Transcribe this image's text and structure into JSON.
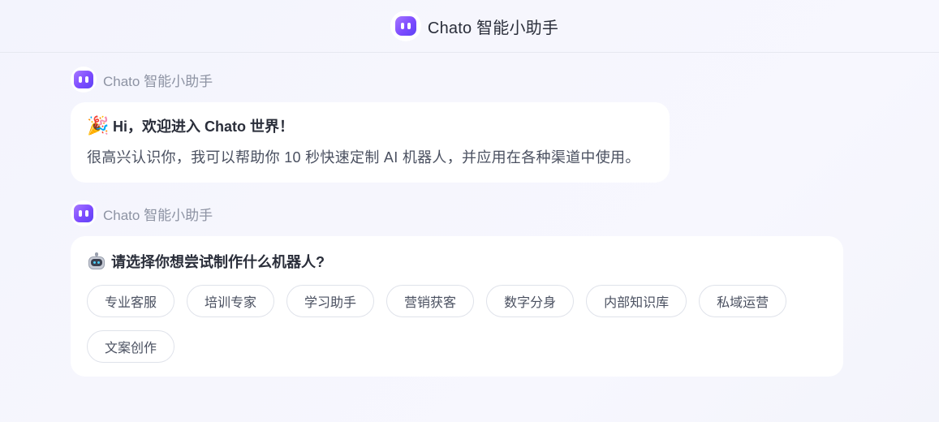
{
  "header": {
    "title": "Chato 智能小助手",
    "logo_icon": "chato-robot-logo-icon"
  },
  "messages": [
    {
      "sender": "Chato 智能小助手",
      "title_emoji": "🎉",
      "title": "Hi，欢迎进入 Chato 世界！",
      "text": "很高兴认识你，我可以帮助你 10 秒快速定制 AI 机器人，并应用在各种渠道中使用。"
    },
    {
      "sender": "Chato 智能小助手",
      "title_emoji_icon": "robot-face-icon",
      "title": "请选择你想尝试制作什么机器人?",
      "options": [
        "专业客服",
        "培训专家",
        "学习助手",
        "营销获客",
        "数字分身",
        "内部知识库",
        "私域运营",
        "文案创作"
      ]
    }
  ],
  "colors": {
    "accent": "#7d4bff",
    "bubble_bg": "#ffffff",
    "chip_border": "#dfe2ea"
  }
}
